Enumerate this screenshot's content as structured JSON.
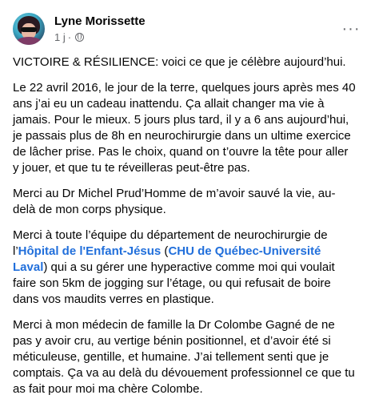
{
  "post": {
    "author": "Lyne Morissette",
    "time": "1 j",
    "separator": "·",
    "privacy_icon": "globe-icon",
    "more_icon": "more-options-icon",
    "more_label": "···"
  },
  "paragraphs": {
    "p1": "VICTOIRE & RÉSILIENCE: voici ce que je célèbre aujourd’hui.",
    "p2": "Le 22 avril 2016, le jour de la terre, quelques jours après mes 40 ans j’ai eu un cadeau inattendu. Ça allait changer ma vie à jamais. Pour le mieux. 5 jours plus tard, il y a 6 ans aujourd’hui, je passais plus de 8h en neurochirurgie dans un ultime exercice de lâcher prise. Pas le choix, quand on t’ouvre la tête pour aller y jouer, et que tu te réveilleras peut-être pas.",
    "p3": "Merci au Dr Michel Prud’Homme de m’avoir sauvé la vie, au-delà de mon corps physique.",
    "p4_before": "Merci à toute l’équipe du département de neurochirurgie de l’",
    "p4_link1": "Hôpital de l'Enfant-Jésus",
    "p4_mid": " (",
    "p4_link2": "CHU de Québec-Université Laval",
    "p4_after": ") qui a su gérer une hyperactive comme moi qui voulait faire son 5km de jogging sur l’étage, ou qui refusait de boire dans vos maudits verres en plastique.",
    "p5": "Merci à mon médecin de famille la Dr Colombe Gagné de ne pas y avoir cru, au vertige bénin positionnel, et d’avoir été si méticuleuse, gentille, et humaine. J’ai tellement senti que je comptais. Ça va au delà du dévouement professionnel ce que tu as fait pour moi ma chère Colombe."
  }
}
